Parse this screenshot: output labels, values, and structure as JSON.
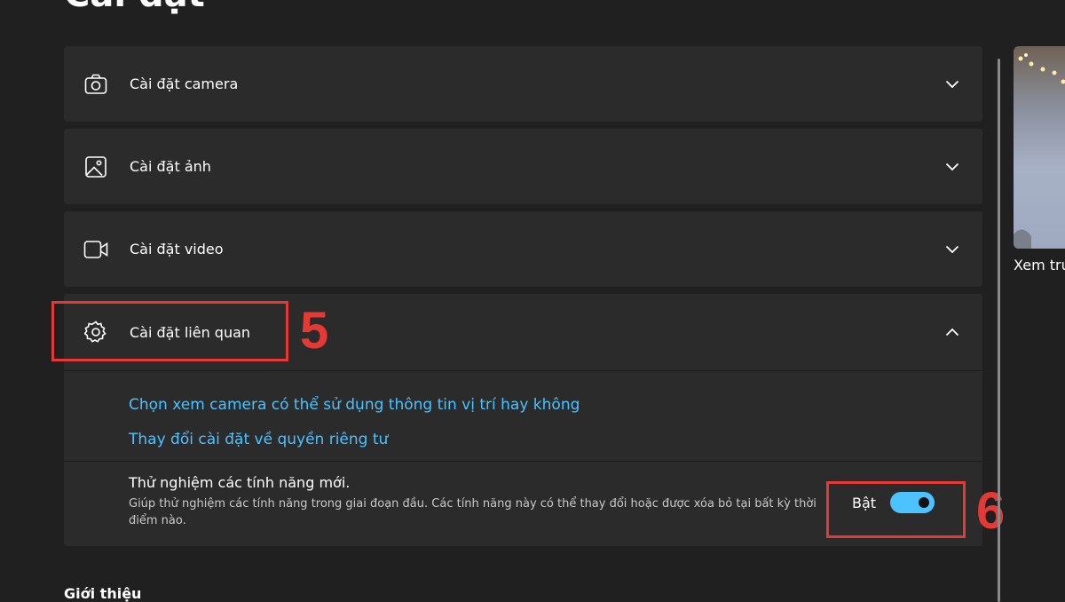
{
  "page": {
    "title": "Cài đặt"
  },
  "settings": {
    "camera": {
      "label": "Cài đặt camera"
    },
    "photo": {
      "label": "Cài đặt ảnh"
    },
    "video": {
      "label": "Cài đặt video"
    },
    "related": {
      "label": "Cài đặt liên quan",
      "links": [
        "Chọn xem camera có thể sử dụng thông tin vị trí hay không",
        "Thay đổi cài đặt về quyền riêng tư"
      ]
    },
    "experimental": {
      "title": "Thử nghiệm các tính năng mới.",
      "description": "Giúp thử nghiệm các tính năng trong giai đoạn đầu. Các tính năng này có thể thay đổi hoặc được xóa bỏ tại bất kỳ thời điểm nào.",
      "toggle_label": "Bật",
      "toggle_on": true
    }
  },
  "about": {
    "heading": "Giới thiệu"
  },
  "preview": {
    "caption": "Xem tru"
  },
  "annotations": {
    "step5": "5",
    "step6": "6"
  },
  "colors": {
    "accent": "#4cc2ff",
    "annotation": "#e53935",
    "card": "#2b2b2b",
    "background": "#202020"
  },
  "icons": [
    "camera-icon",
    "image-icon",
    "video-icon",
    "gear-icon",
    "chevron-down-icon",
    "chevron-up-icon"
  ]
}
